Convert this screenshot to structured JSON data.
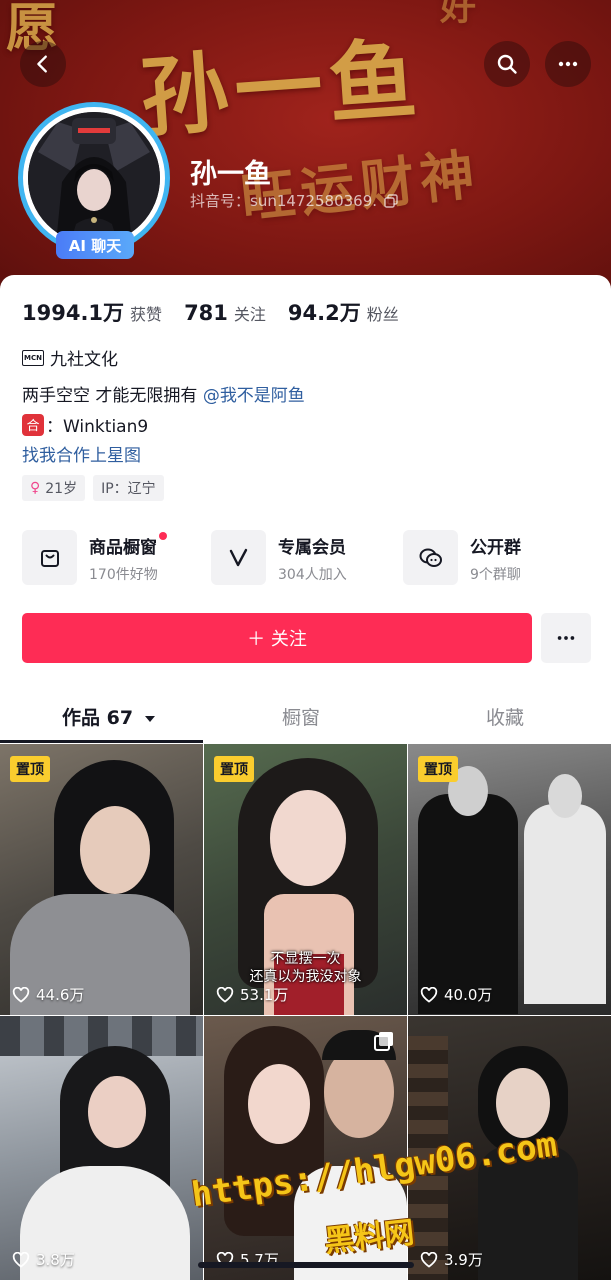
{
  "header": {
    "deco_main": "孙一鱼",
    "deco_sub": "旺运财神",
    "deco_corner": "愿",
    "deco_corner2": "好"
  },
  "profile": {
    "nickname": "孙一鱼",
    "douyin_id": "抖音号：sun1472580369.",
    "ai_chip": "AI 聊天"
  },
  "stats": [
    {
      "num": "1994.1万",
      "label": "获赞"
    },
    {
      "num": "781",
      "label": "关注"
    },
    {
      "num": "94.2万",
      "label": "粉丝"
    }
  ],
  "mcn": {
    "icon_text": "MCN",
    "name": "九社文化"
  },
  "bio": {
    "text": "两手空空 才能无限拥有 ",
    "mention": "@我不是阿鱼"
  },
  "contact": {
    "badge": "合",
    "text": "：Winktian9"
  },
  "xingtu_link": "找我合作上星图",
  "tags": {
    "age": "21岁",
    "ip": "IP：辽宁"
  },
  "services": [
    {
      "title": "商品橱窗",
      "sub": "170件好物",
      "icon": "shopping-bag-icon"
    },
    {
      "title": "专属会员",
      "sub": "304人加入",
      "icon": "v-member-icon"
    },
    {
      "title": "公开群",
      "sub": "9个群聊",
      "icon": "chat-bubbles-icon"
    }
  ],
  "actions": {
    "follow": "＋ 关注"
  },
  "tabs": [
    {
      "label": "作品 67"
    },
    {
      "label": "橱窗"
    },
    {
      "label": "收藏"
    }
  ],
  "videos": [
    {
      "pinned": "置顶",
      "likes": "44.6万",
      "caption": ""
    },
    {
      "pinned": "置顶",
      "likes": "53.1万",
      "caption_line1": "不显摆一次",
      "caption_line2": "还真以为我没对象"
    },
    {
      "pinned": "置顶",
      "likes": "40.0万",
      "caption": ""
    },
    {
      "likes": "3.8万"
    },
    {
      "likes": "5.7万"
    },
    {
      "likes": "3.9万"
    }
  ],
  "watermark": {
    "url": "https://hlgw06.com",
    "name": "黑料网"
  },
  "colors": {
    "brand_red": "#fe2c55",
    "link_blue": "#2f5e9f",
    "pin_yellow": "#facd2e",
    "banner_red": "#7c1712"
  }
}
